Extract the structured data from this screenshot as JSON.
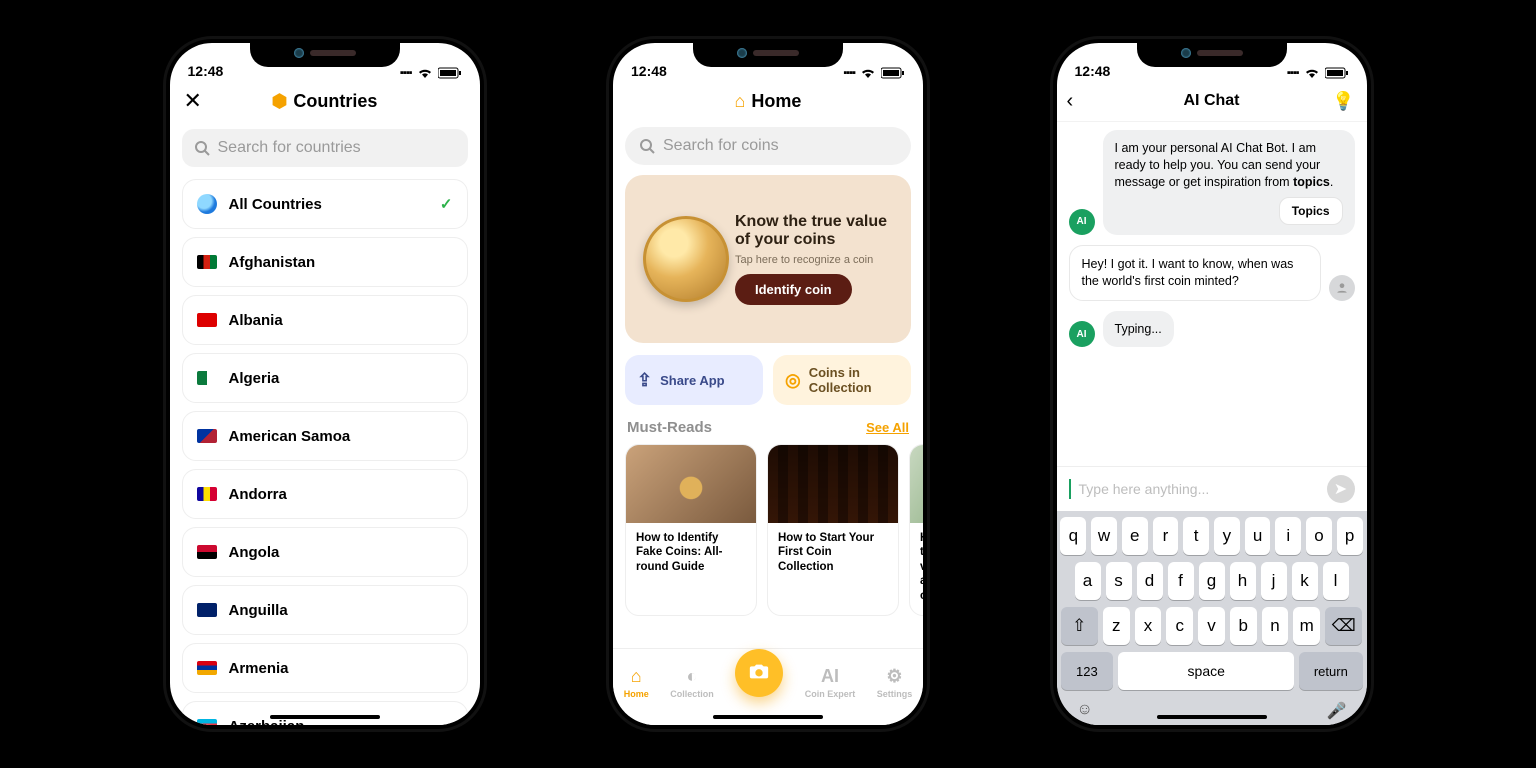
{
  "status": {
    "time": "12:48"
  },
  "screen1": {
    "title": "Countries",
    "search_placeholder": "Search for countries",
    "selected_index": 0,
    "countries": [
      {
        "name": "All Countries",
        "flag_css": "globe"
      },
      {
        "name": "Afghanistan",
        "flag_css": "background:linear-gradient(90deg,#000 0 33%,#d32011 33% 66%,#007a36 66%);"
      },
      {
        "name": "Albania",
        "flag_css": "background:#d00;"
      },
      {
        "name": "Algeria",
        "flag_css": "background:linear-gradient(90deg,#0b7a3d 0 50%,#fff 50%);"
      },
      {
        "name": "American Samoa",
        "flag_css": "background:linear-gradient(135deg,#0033a0 0 50%,#b22234 50%);"
      },
      {
        "name": "Andorra",
        "flag_css": "background:linear-gradient(90deg,#10069f 0 33%,#fedd00 33% 66%,#d50032 66%);"
      },
      {
        "name": "Angola",
        "flag_css": "background:linear-gradient(#cc092f 0 50%,#000 50%);"
      },
      {
        "name": "Anguilla",
        "flag_css": "background:#012169;"
      },
      {
        "name": "Armenia",
        "flag_css": "background:linear-gradient(#d90012 0 33%,#0033a0 33% 66%,#f2a800 66%);"
      },
      {
        "name": "Azerbaijan",
        "flag_css": "background:linear-gradient(#00b5e2 0 33%,#ef3340 33% 66%,#509e2f 66%);"
      }
    ]
  },
  "screen2": {
    "title": "Home",
    "search_placeholder": "Search for coins",
    "hero": {
      "heading": "Know the true value of your coins",
      "sub": "Tap here to recognize a coin",
      "button": "Identify coin"
    },
    "tile_share": "Share App",
    "tile_collection": "Coins in Collection",
    "mustreads_label": "Must-Reads",
    "see_all": "See All",
    "reads": [
      {
        "title": "How to Identify Fake Coins: All-round Guide"
      },
      {
        "title": "How to Start Your First Coin Collection"
      },
      {
        "title": "How to v a c"
      }
    ],
    "nav": {
      "home": "Home",
      "collection": "Collection",
      "coin_expert": "Coin Expert",
      "settings": "Settings"
    }
  },
  "screen3": {
    "title": "AI Chat",
    "messages": {
      "bot_intro_prefix": "I am your personal AI Chat Bot. I am ready to help you. You can send your message or get inspiration from ",
      "bot_intro_bold": "topics",
      "bot_intro_suffix": ".",
      "topics_button": "Topics",
      "user_msg": "Hey! I got it. I want to know, when was the world's first coin minted?",
      "typing": "Typing..."
    },
    "input_placeholder": "Type here anything...",
    "keyboard": {
      "row1": [
        "q",
        "w",
        "e",
        "r",
        "t",
        "y",
        "u",
        "i",
        "o",
        "p"
      ],
      "row2": [
        "a",
        "s",
        "d",
        "f",
        "g",
        "h",
        "j",
        "k",
        "l"
      ],
      "row3_letters": [
        "z",
        "x",
        "c",
        "v",
        "b",
        "n",
        "m"
      ],
      "num": "123",
      "space": "space",
      "return": "return"
    }
  }
}
